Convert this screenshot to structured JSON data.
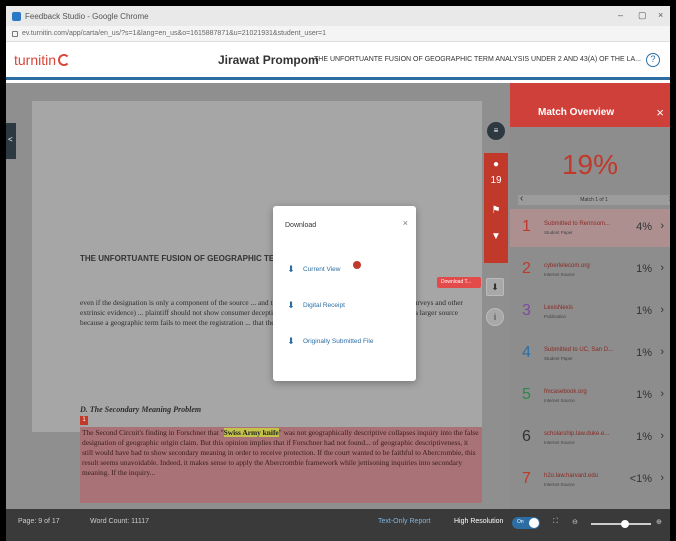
{
  "browser": {
    "window_title": "Feedback Studio - Google Chrome",
    "url": "ev.turnitin.com/app/carta/en_us/?s=1&lang=en_us&o=1615887871&u=21021931&student_user=1",
    "minimize": "–",
    "maximize": "▢",
    "close": "×"
  },
  "header": {
    "logo_text": "turnitin",
    "student_name": "Jirawat Prompom",
    "document_title": "THE UNFORTUANTE FUSION OF GEOGRAPHIC TERM ANALYSIS UNDER 2 AND 43(A) OF THE LA...",
    "help": "?"
  },
  "document": {
    "left_tab": "<",
    "heading": "THE UNFORTUANTE FUSION OF GEOGRAPHIC TE",
    "paragraph1": "even if the designation is only a component of the source ... and that consumers were deceived (presumably via surveys and other extrinsic evidence) ... plaintiff should not show consumer deception as to origin simply because ... component of a larger source because a geographic term fails to meet the registration ... that the term is deceiving consumers.",
    "subheading": "D. The Secondary Meaning Problem",
    "marker": "1",
    "hl_pre": "The Second Circuit's finding in Forschner that \"",
    "hl_term": "Swiss Army knife",
    "hl_post": "\" was not geographically descriptive collapses inquiry into the false designation of geographic origin claim. But this opinion implies that if Forschner had not found... of geographic descriptiveness, it still would have had to show secondary meaning in order to receive protection. If the court wanted to be faithful to Abercrombie, this result seems unavoidable. Indeed, it makes sense to apply the Abercrombie framework while jettisoning inquiries into secondary meaning. If the inquiry..."
  },
  "toolbar": {
    "layers": "≡",
    "match_count": "19",
    "filter": "⚑",
    "funnel": "▼",
    "download": "⬇",
    "info": "i",
    "tooltip": "Download T..."
  },
  "download_modal": {
    "title": "Download",
    "close": "×",
    "options": [
      "Current View",
      "Digital Receipt",
      "Originally Submitted File"
    ]
  },
  "match_overview": {
    "title": "Match Overview",
    "close": "×",
    "score": "19%",
    "nav_label": "Match 1 of 1",
    "sources": [
      {
        "num": "1",
        "name": "Submitted to Rennsom...",
        "type": "Student Paper",
        "pct": "4%",
        "color": "#c0392b"
      },
      {
        "num": "2",
        "name": "cyberlelecom.org",
        "type": "Internet Source",
        "pct": "1%",
        "color": "#c0392b"
      },
      {
        "num": "3",
        "name": "LexisNexis",
        "type": "Publication",
        "pct": "1%",
        "color": "#7a4b9e"
      },
      {
        "num": "4",
        "name": "Submitted to UC, San D...",
        "type": "Student Paper",
        "pct": "1%",
        "color": "#2c6ea3"
      },
      {
        "num": "5",
        "name": "fmcasebook.org",
        "type": "Internet Source",
        "pct": "1%",
        "color": "#2a8a4a"
      },
      {
        "num": "6",
        "name": "scholarship.law.duke.e...",
        "type": "Internet Source",
        "pct": "1%",
        "color": "#333333"
      },
      {
        "num": "7",
        "name": "h2o.law.harvard.edu",
        "type": "Internet Source",
        "pct": "<1%",
        "color": "#c0392b"
      }
    ]
  },
  "statusbar": {
    "page": "Page: 9 of 17",
    "word_count": "Word Count: 11117",
    "text_only": "Text-Only Report",
    "high_res": "High Resolution",
    "toggle": "On",
    "zoom_out": "⊖",
    "zoom_in": "⊕",
    "fit": "⛶"
  }
}
